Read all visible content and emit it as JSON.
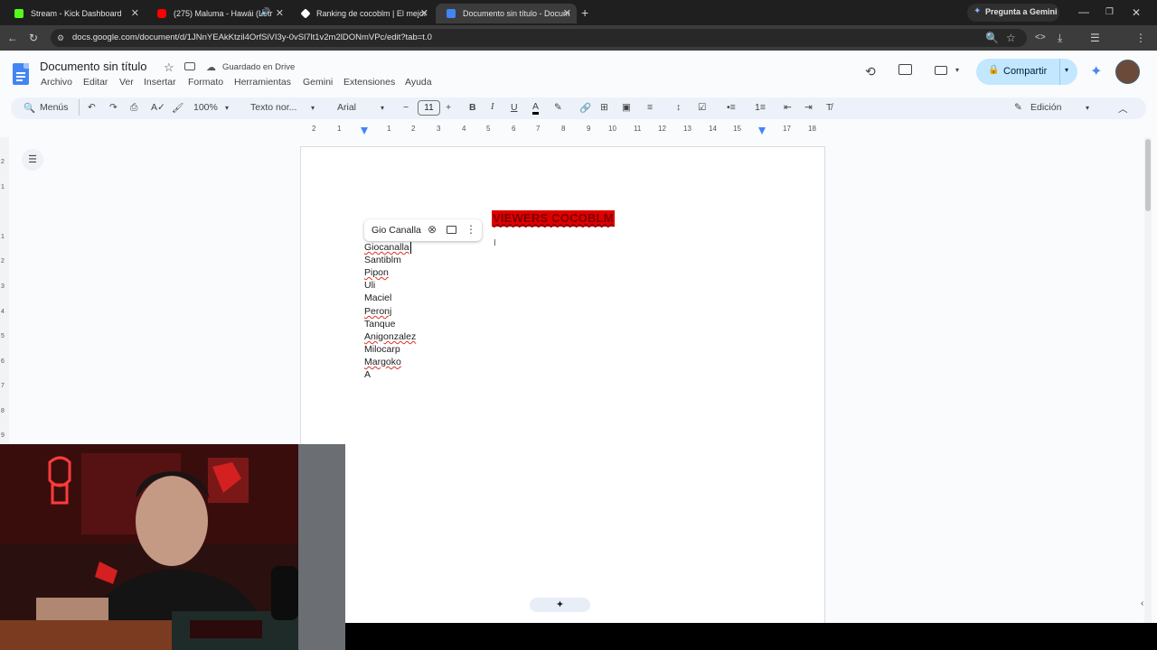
{
  "browser": {
    "tabs": [
      {
        "title": "Stream - Kick Dashboard",
        "favicon_color": "#53fc18"
      },
      {
        "title": "(275) Maluma - Hawái (Letr",
        "favicon_color": "#ff0000"
      },
      {
        "title": "Ranking de cocoblm | El mejor",
        "favicon_color": "#ffffff"
      },
      {
        "title": "Documento sin título - Docum",
        "favicon_color": "#4285f4"
      }
    ],
    "gemini_label": "Pregunta a Gemini",
    "url": "docs.google.com/document/d/1JNnYEAkKtzil4OrfSiVI3y-0vSl7lt1v2m2lDONmVPc/edit?tab=t.0"
  },
  "docs": {
    "title": "Documento sin título",
    "saved_status": "Guardado en Drive",
    "menu": [
      "Archivo",
      "Editar",
      "Ver",
      "Insertar",
      "Formato",
      "Herramientas",
      "Gemini",
      "Extensiones",
      "Ayuda"
    ],
    "share_label": "Compartir",
    "toolbar": {
      "search_label": "Menús",
      "zoom": "100%",
      "style": "Texto nor...",
      "font": "Arial",
      "font_size": "11",
      "mode": "Edición"
    },
    "ruler_numbers": [
      "2",
      "1",
      "1",
      "2",
      "3",
      "4",
      "5",
      "6",
      "7",
      "8",
      "9",
      "10",
      "11",
      "12",
      "13",
      "14",
      "15",
      "16",
      "17",
      "18"
    ],
    "vruler_numbers": [
      "2",
      "1",
      "1",
      "2",
      "3",
      "4",
      "5",
      "6",
      "7",
      "8",
      "9"
    ]
  },
  "document": {
    "heading": "VIEWERS COCOBLM",
    "heading_bg": "#e00000",
    "names": [
      {
        "text": "Giocanalla",
        "misspelled": true
      },
      {
        "text": "Santiblm",
        "misspelled": false
      },
      {
        "text": "Pipon",
        "misspelled": true
      },
      {
        "text": "Uli",
        "misspelled": false
      },
      {
        "text": "Maciel",
        "misspelled": false
      },
      {
        "text": "Peronj",
        "misspelled": true
      },
      {
        "text": "Tanque",
        "misspelled": false
      },
      {
        "text": "Anigonzalez",
        "misspelled": true
      },
      {
        "text": "Milocarp",
        "misspelled": false
      },
      {
        "text": "Margoko",
        "misspelled": true
      },
      {
        "text": "A",
        "misspelled": false
      }
    ],
    "suggestion_chip": "Gio Canalla"
  }
}
